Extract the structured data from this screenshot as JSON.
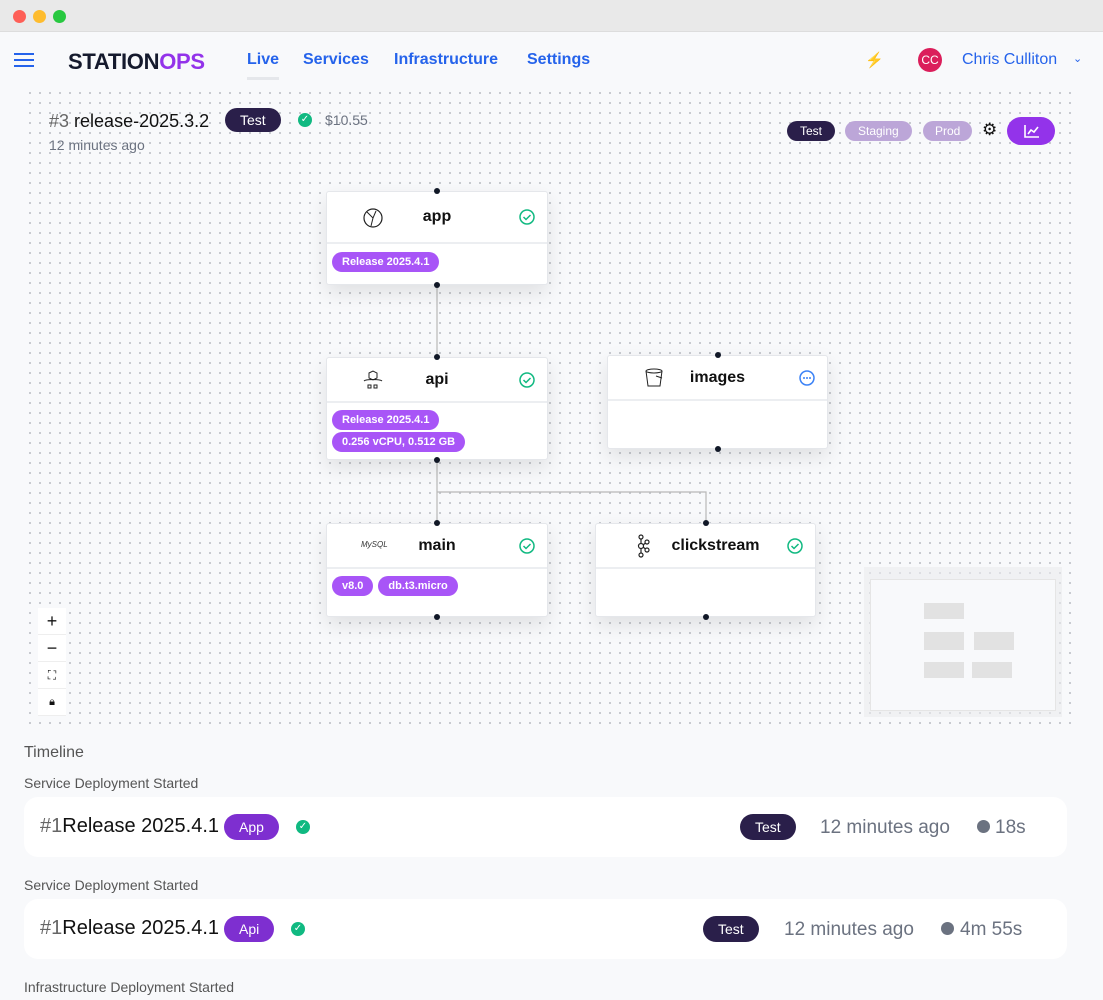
{
  "header": {
    "brand_a": "STATION",
    "brand_b": "OPS",
    "nav": [
      {
        "label": "Live",
        "active": true
      },
      {
        "label": "Services"
      },
      {
        "label": "Infrastructure"
      },
      {
        "label": "Settings"
      }
    ],
    "user_initials": "CC",
    "user_name": "Chris Culliton"
  },
  "release": {
    "number": "#3",
    "name": "release-2025.3.2",
    "env": "Test",
    "status": "success",
    "cost": "$10.55",
    "time": "12 minutes ago"
  },
  "env_filters": [
    "Test",
    "Staging",
    "Prod"
  ],
  "nodes": {
    "app": {
      "name": "app",
      "icon": "globe-icon",
      "status": "success",
      "tags": [
        "Release 2025.4.1"
      ]
    },
    "api": {
      "name": "api",
      "icon": "container-icon",
      "status": "success",
      "tags": [
        "Release 2025.4.1",
        "0.256 vCPU, 0.512 GB"
      ]
    },
    "images": {
      "name": "images",
      "icon": "bucket-icon",
      "status": "pending",
      "tags": []
    },
    "main": {
      "name": "main",
      "icon": "mysql-icon",
      "icon_text": "MySQL",
      "status": "success",
      "tags": [
        "v8.0",
        "db.t3.micro"
      ]
    },
    "clickstream": {
      "name": "clickstream",
      "icon": "kafka-icon",
      "status": "success",
      "tags": []
    }
  },
  "timeline": {
    "title": "Timeline",
    "events": [
      {
        "label": "Service Deployment Started",
        "number": "#1",
        "name": "Release 2025.4.1",
        "service": "App",
        "status": "success",
        "env": "Test",
        "time": "12 minutes ago",
        "duration": "18s"
      },
      {
        "label": "Service Deployment Started",
        "number": "#1",
        "name": "Release 2025.4.1",
        "service": "Api",
        "status": "success",
        "env": "Test",
        "time": "12 minutes ago",
        "duration": "4m 55s"
      },
      {
        "label": "Infrastructure Deployment Started"
      }
    ]
  },
  "colors": {
    "brand_purple": "#9333ea",
    "nav_blue": "#2563eb",
    "success": "#10b981",
    "env_dark": "#2a1f4a",
    "tag_purple": "#a855f7"
  }
}
